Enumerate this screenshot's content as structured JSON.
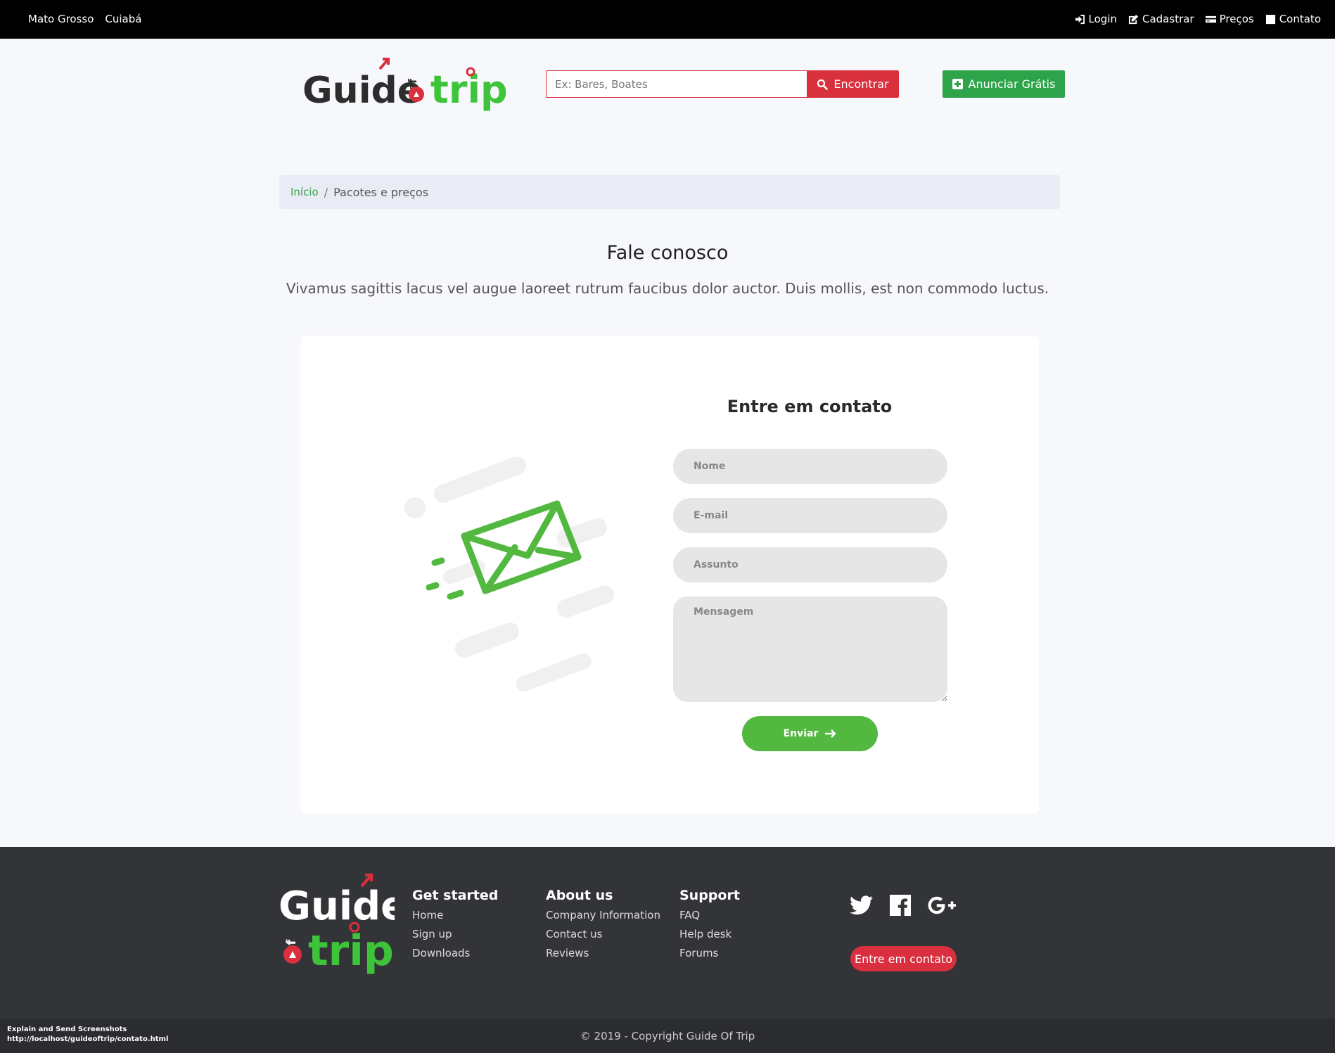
{
  "topbar": {
    "state": "Mato Grosso",
    "city": "Cuiabá",
    "nav": [
      {
        "label": "Login",
        "icon": "login-icon"
      },
      {
        "label": "Cadastrar",
        "icon": "edit-icon"
      },
      {
        "label": "Preços",
        "icon": "card-icon"
      },
      {
        "label": "Contato",
        "icon": "contact-icon"
      }
    ]
  },
  "header": {
    "logo_word1": "Guide",
    "logo_word2": "of",
    "logo_word3": "trip",
    "search_placeholder": "Ex: Bares, Boates",
    "search_button": "Encontrar",
    "announce_button": "Anunciar Grátis"
  },
  "breadcrumb": {
    "home": "Início",
    "current": "Pacotes e preços"
  },
  "page": {
    "title": "Fale conosco",
    "subtitle": "Vivamus sagittis lacus vel augue laoreet rutrum faucibus dolor auctor. Duis mollis, est non commodo luctus."
  },
  "form": {
    "title": "Entre em contato",
    "name_placeholder": "Nome",
    "email_placeholder": "E-mail",
    "subject_placeholder": "Assunto",
    "message_placeholder": "Mensagem",
    "submit": "Enviar"
  },
  "footer": {
    "columns": [
      {
        "heading": "Get started",
        "links": [
          "Home",
          "Sign up",
          "Downloads"
        ]
      },
      {
        "heading": "About us",
        "links": [
          "Company Information",
          "Contact us",
          "Reviews"
        ]
      },
      {
        "heading": "Support",
        "links": [
          "FAQ",
          "Help desk",
          "Forums"
        ]
      }
    ],
    "social": [
      "twitter-icon",
      "facebook-icon",
      "google-plus-icon"
    ],
    "contact_button": "Entre em contato",
    "copyright": "© 2019 - Copyright Guide Of Trip"
  },
  "overlay": {
    "line1": "Explain and Send Screenshots",
    "line2": "http://localhost/guideoftrip/contato.html"
  },
  "colors": {
    "brand_red": "#d9303e",
    "brand_green": "#2ea44a",
    "send_green": "#52b840",
    "footer_bg": "#333438"
  }
}
